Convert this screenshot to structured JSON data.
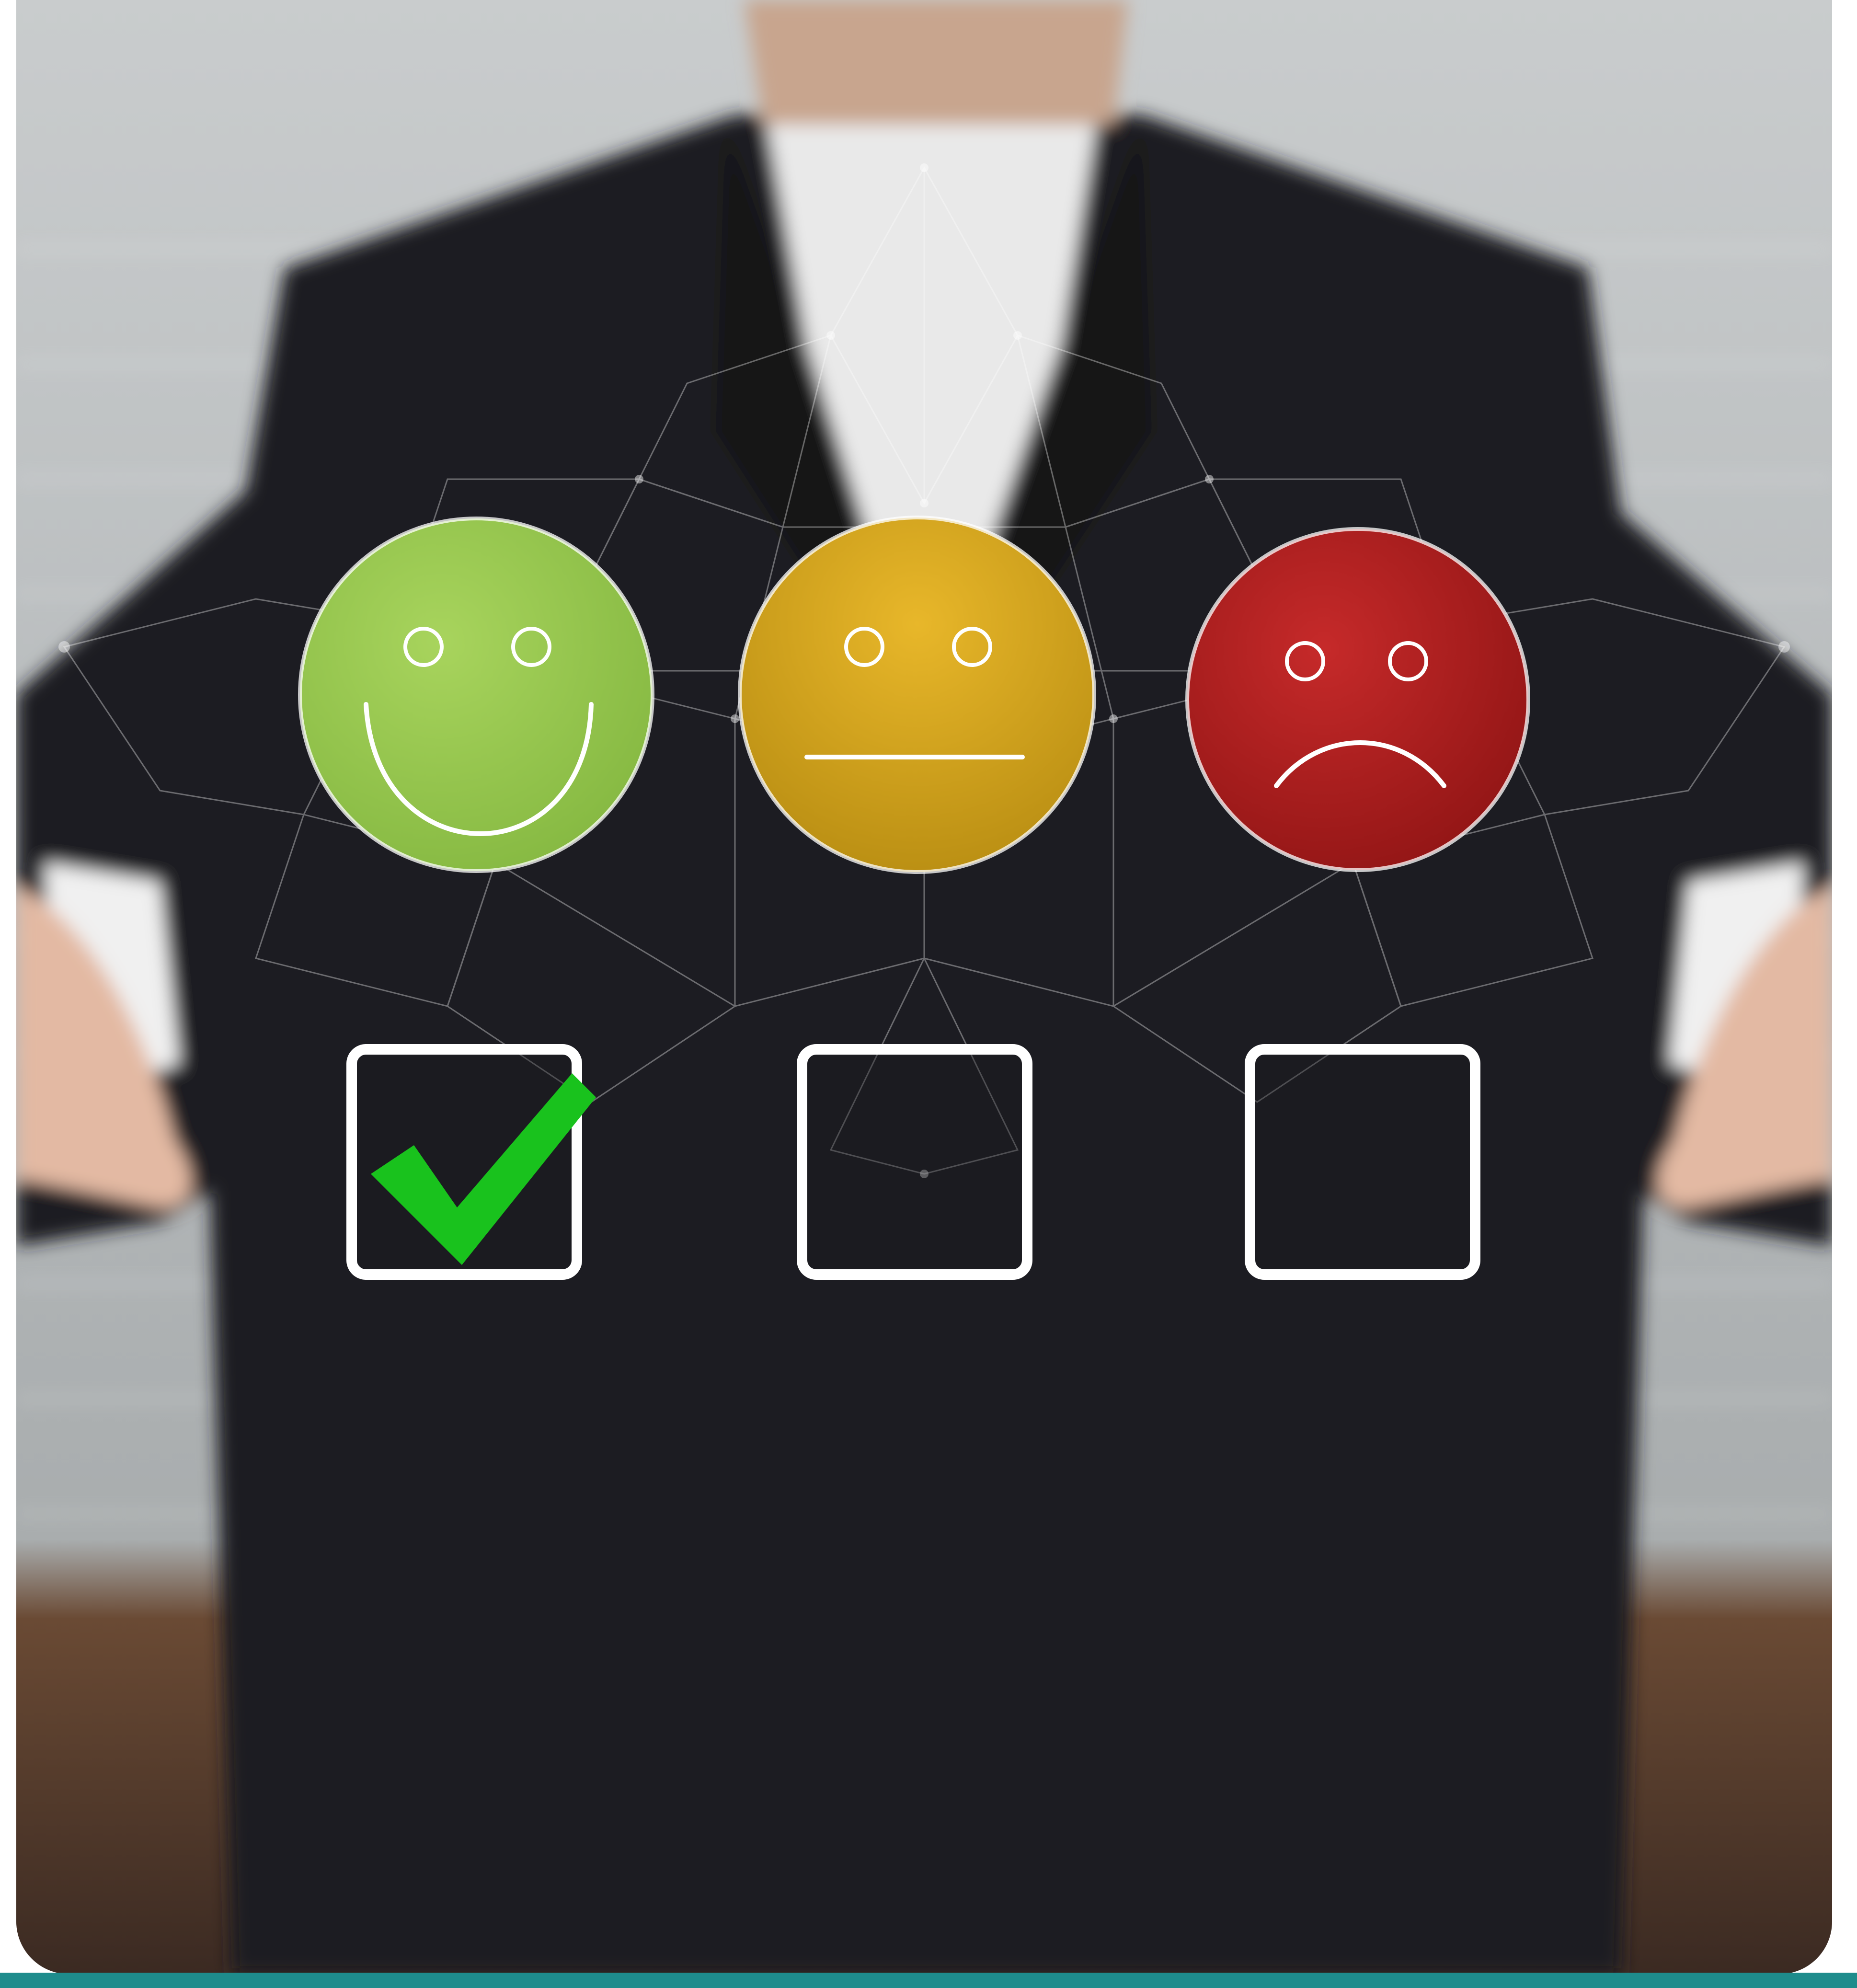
{
  "scene": {
    "subject": "person-in-dark-suit",
    "overlay": "network-mesh",
    "colors": {
      "background_gray": "#b9bdbf",
      "suit": "#1e1f22",
      "shirt": "#e9e9e9",
      "mesh": "#ffffff",
      "accent_bar": "#1e8c8c"
    }
  },
  "rating_options": [
    {
      "mood": "happy",
      "icon": "happy-face-icon",
      "color": "#97c64d",
      "selected": true
    },
    {
      "mood": "neutral",
      "icon": "neutral-face-icon",
      "color": "#d2a31c",
      "selected": false
    },
    {
      "mood": "sad",
      "icon": "sad-face-icon",
      "color": "#b01f1f",
      "selected": false
    }
  ],
  "checkmark": {
    "icon": "checkmark-icon",
    "color": "#19c21d"
  }
}
